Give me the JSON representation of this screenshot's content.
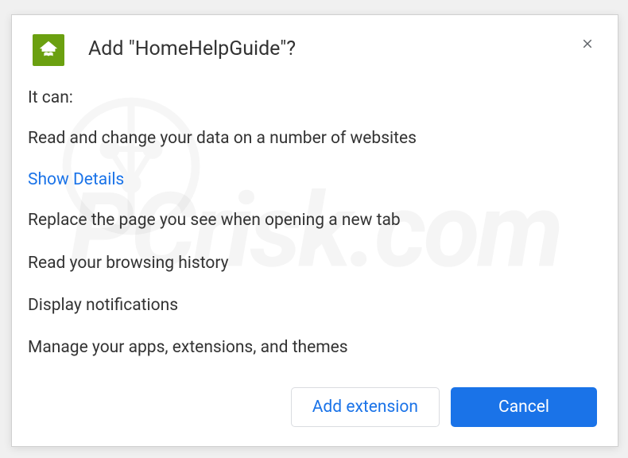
{
  "dialog": {
    "title": "Add \"HomeHelpGuide\"?",
    "intro": "It can:",
    "permissions": [
      "Read and change your data on a number of websites",
      "Replace the page you see when opening a new tab",
      "Read your browsing history",
      "Display notifications",
      "Manage your apps, extensions, and themes"
    ],
    "showDetails": "Show Details",
    "buttons": {
      "add": "Add extension",
      "cancel": "Cancel"
    },
    "icon": {
      "name": "home-help-guide-icon",
      "bgColor": "#6ba010"
    }
  },
  "watermark": "PCrisk.com"
}
